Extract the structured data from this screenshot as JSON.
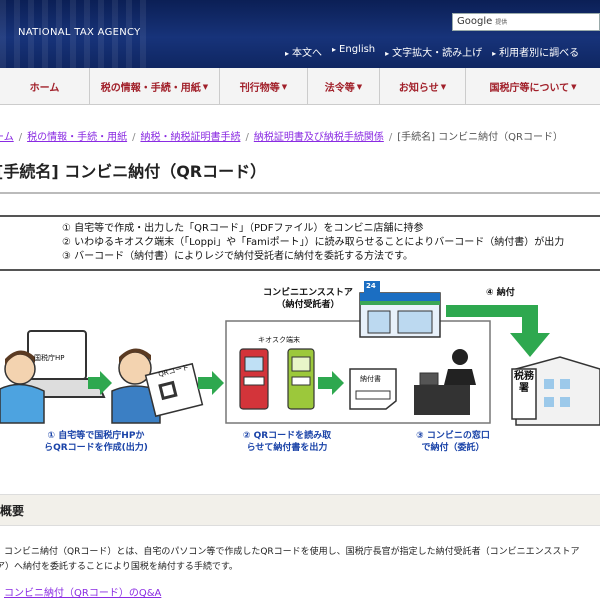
{
  "header": {
    "agency_name": "NATIONAL TAX AGENCY",
    "search_brand": "Google",
    "search_placeholder": "提供",
    "utility_links": [
      "本文へ",
      "English",
      "文字拡大・読み上げ",
      "利用者別に調べる"
    ]
  },
  "nav": {
    "items": [
      {
        "label": "ホーム",
        "has_caret": false
      },
      {
        "label": "税の情報・手続・用紙",
        "has_caret": true
      },
      {
        "label": "刊行物等",
        "has_caret": true
      },
      {
        "label": "法令等",
        "has_caret": true
      },
      {
        "label": "お知らせ",
        "has_caret": true
      },
      {
        "label": "国税庁等について",
        "has_caret": true
      }
    ]
  },
  "breadcrumb": {
    "links": [
      "ーム",
      "税の情報・手続・用紙",
      "納税・納税証明書手続",
      "納税証明書及び納税手続関係"
    ],
    "current": "[手続名] コンビニ納付（QRコード）"
  },
  "page_title": "[手続名] コンビニ納付（QRコード）",
  "steps": [
    "① 自宅等で作成・出力した「QRコード」（PDFファイル）をコンビニ店舗に持参",
    "② いわゆるキオスク端末（「Loppi」や「Famiポート」）に読み取らせることによりバーコード（納付書）が出力",
    "③ バーコード（納付書）によりレジで納付受託者に納付を委託する方法です。"
  ],
  "diagram": {
    "laptop_label": "国税庁HP",
    "qr_label": "QRコード",
    "store_title_1": "コンビニエンスストア",
    "store_title_2": "（納付受託者）",
    "store_sign": "24",
    "kiosk_label": "キオスク端末",
    "slip_label": "納付書",
    "tax_office_label": "税務署",
    "step1_line1": "① 自宅等で国税庁HPか",
    "step1_line2": "らQRコードを作成(出力)",
    "step2_line1": "② QRコードを読み取",
    "step2_line2": "らせて納付書を出力",
    "step3_line1": "③ コンビニの窓口",
    "step3_line2": "で納付（委託）",
    "step4_label": "④ 納付",
    "colors": {
      "arrow_green": "#2ea84f",
      "label_blue": "#1a43a8",
      "store_blue": "#1b6ec2",
      "store_green": "#3aa655"
    }
  },
  "overview": {
    "heading": "概要",
    "text_line1": "コンビニ納付（QRコード）とは、自宅のパソコン等で作成したQRコードを使用し、国税庁長官が指定した納付受託者（コンビニエンスストア",
    "text_line2": "ア）へ納付を委託することにより国税を納付する手続です。",
    "qa_link": "コンビニ納付（QRコード）のQ&A"
  }
}
